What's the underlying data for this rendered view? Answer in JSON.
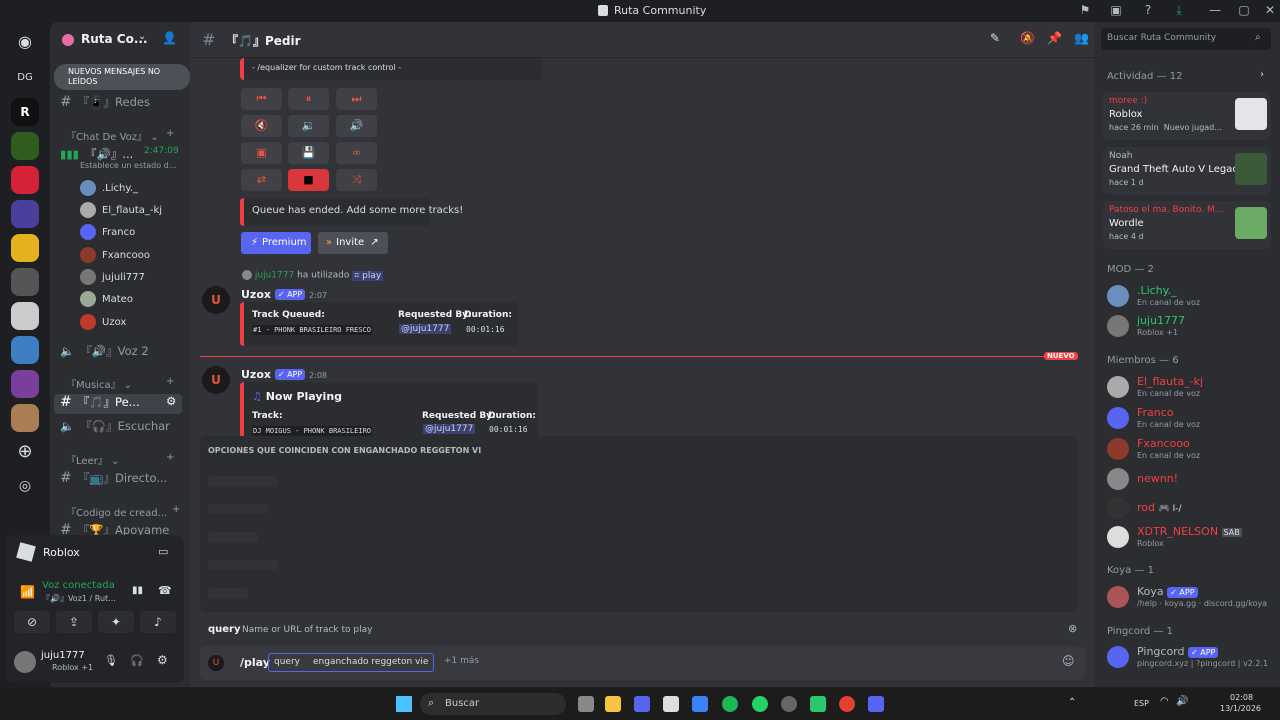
{
  "window": {
    "title": "Ruta Community"
  },
  "server": {
    "name": "Ruta Co...",
    "unread_banner": "NUEVOS MENSAJES NO LEÍDOS",
    "dg_label": "DG"
  },
  "channels": {
    "redes": "『📱』Redes",
    "cat_voz": "『Chat De Voz』",
    "voice1_name": "『🔊』...",
    "voice1_time": "2:47:09",
    "voice1_status": "Establece un estado d...",
    "voice_users": [
      ".Lichy._",
      "El_flauta_-kj",
      "Franco",
      "Fxancooo",
      "jujuli777",
      "Mateo",
      "Uzox"
    ],
    "voz2": "『🔊』Voz 2",
    "cat_musica": "『Musica』",
    "pedir": "『🎵』Pe...",
    "escuchar": "『🎧』Escuchar",
    "cat_leer": "『Leer』",
    "directo": "『📺』Directo...",
    "cat_codigo": "『Codigo de cread...",
    "apoyame": "『🏆』Apoyame"
  },
  "user_panel": {
    "activity": "Roblox",
    "voice_connected": "Voz conectada",
    "voice_channel": "『🔊』Voz1 / Rut...",
    "username": "juju1777",
    "status": "Roblox +1"
  },
  "chat_header": {
    "channel": "『🎵』Pedir",
    "search_placeholder": "Buscar Ruta Community"
  },
  "messages": {
    "equalizer_text": "- /equalizer for custom track control -",
    "queue_ended": "Queue has ended. Add some more tracks!",
    "premium_button": "Premium",
    "invite_button": "Invite",
    "used_user": "juju1777",
    "used_text": "ha utilizado",
    "used_cmd": "play",
    "bot_name": "Uzox",
    "app_badge": "APP",
    "time1": "2:07",
    "queued_title": "Track Queued:",
    "queued_track": "#1 - PHONK BRASILEIRO FRESCO",
    "requested_by": "Requested By:",
    "requester": "@juju1777",
    "duration": "Duration:",
    "duration_val": "00:01:16",
    "new_label": "NUEVO",
    "time2": "2:08",
    "now_playing": "Now Playing",
    "track_label": "Track:",
    "now_track": "DJ MOIGUS - PHONK BRASILEIRO"
  },
  "autocomplete": {
    "title": "OPCIONES QUE COINCIDEN CON ENGANCHADO REGGETON VI",
    "param_name": "query",
    "param_desc": "Name or URL of track to play"
  },
  "composer": {
    "command": "/play",
    "param": "query",
    "value": "enganchado reggeton vie",
    "more": "+1 más"
  },
  "members": {
    "activity_header": "Actividad — 12",
    "activities": [
      {
        "user": "moree :)",
        "game": "Roblox",
        "time": "hace 26 min",
        "extra": "Nuevo jugad..."
      },
      {
        "user": "Noah",
        "game": "Grand Theft Auto V Legacy",
        "time": "hace 1 d",
        "extra": ""
      },
      {
        "user": "Patoso el ma. Bonito. M...",
        "game": "Wordle",
        "time": "hace 4 d",
        "extra": ""
      }
    ],
    "mod_header": "MOD — 2",
    "mods": [
      {
        "name": ".Lichy._",
        "status": "En canal de voz",
        "color": "#2dc770"
      },
      {
        "name": "juju1777",
        "status": "Roblox +1",
        "color": "#2dc770"
      }
    ],
    "members_header": "Miembros — 6",
    "list": [
      {
        "name": "El_flauta_-kj",
        "status": "En canal de voz",
        "color": "#f23f43"
      },
      {
        "name": "Franco",
        "status": "En canal de voz",
        "color": "#f23f43"
      },
      {
        "name": "Fxancooo",
        "status": "En canal de voz",
        "color": "#f23f43"
      },
      {
        "name": "newnn!",
        "status": "",
        "color": "#f23f43"
      },
      {
        "name": "rod",
        "status": "",
        "color": "#f23f43",
        "tag": "🎮 I-/"
      },
      {
        "name": "XDTR_NELSON",
        "status": "Roblox",
        "color": "#f23f43",
        "tag": "SAB"
      }
    ],
    "koya_header": "Koya — 1",
    "koya": {
      "name": "Koya",
      "status": "/help · koya.gg · discord.gg/koya"
    },
    "pingcord_header": "Pingcord — 1",
    "pingcord": {
      "name": "Pingcord",
      "status": "pingcord.xyz | ?pingcord | v2.2.1"
    }
  },
  "taskbar": {
    "search": "Buscar",
    "lang": "ESP",
    "time": "02:08",
    "date": "13/1/2026"
  },
  "colors": {
    "accent": "#5865f2",
    "red": "#f23f43",
    "green": "#23a559",
    "bg": "#313338"
  }
}
